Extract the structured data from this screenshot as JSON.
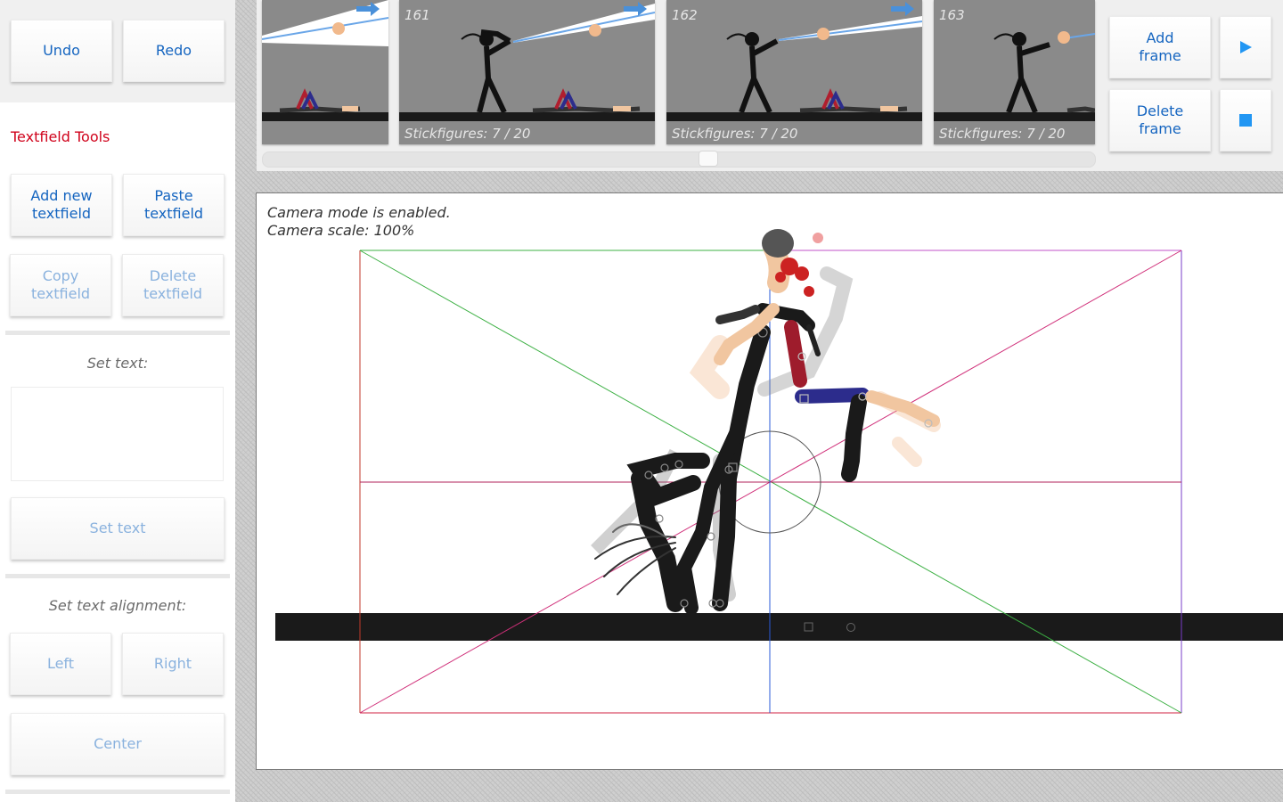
{
  "history": {
    "undo_label": "Undo",
    "redo_label": "Redo"
  },
  "textfield_tools": {
    "title": "Textfield Tools",
    "add_label": "Add new\ntextfield",
    "paste_label": "Paste\ntextfield",
    "copy_label": "Copy\ntextfield",
    "delete_label": "Delete\ntextfield",
    "set_text_caption": "Set text:",
    "text_value": "",
    "set_text_button": "Set text",
    "alignment_caption": "Set text alignment:",
    "align_left": "Left",
    "align_right": "Right",
    "align_center": "Center"
  },
  "frames": {
    "items": [
      {
        "number": "",
        "count_label": ""
      },
      {
        "number": "161",
        "count_label": "Stickfigures: 7 / 20"
      },
      {
        "number": "162",
        "count_label": "Stickfigures: 7 / 20"
      },
      {
        "number": "163",
        "count_label": "Stickfigures: 7 / 20"
      }
    ]
  },
  "frame_controls": {
    "add_label": "Add\nframe",
    "delete_label": "Delete\nframe",
    "play_icon": "play-icon",
    "stop_icon": "stop-icon"
  },
  "canvas": {
    "camera_mode_text": "Camera mode is enabled.",
    "camera_scale_text": "Camera scale: 100%"
  },
  "colors": {
    "accent": "#1565c0",
    "section_title": "#d0021b",
    "play_blue": "#2196f3",
    "ground": "#1a1a1a"
  }
}
